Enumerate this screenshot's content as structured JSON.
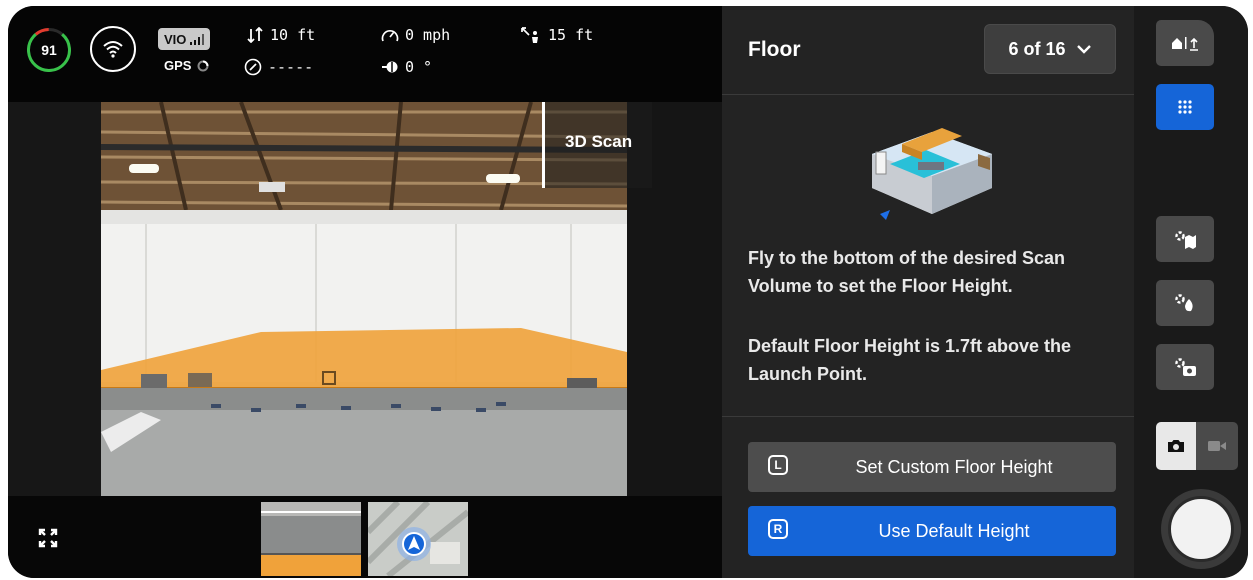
{
  "telemetry": {
    "battery_percent": "91",
    "battery_level": 0.91,
    "vio_label": "VIO",
    "gps_label": "GPS",
    "altitude": "10 ft",
    "heading_value": "-----",
    "speed": "0 mph",
    "gimbal_angle": "0 °",
    "distance": "15 ft"
  },
  "camera": {
    "mode_label": "3D Scan"
  },
  "panel": {
    "title": "Floor",
    "step_label": "6 of 16",
    "instruction_1": "Fly to the bottom of the desired Scan Volume to set the Floor Height.",
    "instruction_2": "Default Floor Height is 1.7ft above the Launch Point.",
    "custom_button_key": "L",
    "custom_button_label": "Set Custom Floor Height",
    "default_button_key": "R",
    "default_button_label": "Use Default Height"
  },
  "colors": {
    "accent_blue": "#1565d8",
    "floor_orange": "#f0a23a",
    "battery_green": "#38c24a",
    "battery_red": "#e23b2e"
  },
  "icons": [
    "battery-ring-icon",
    "wifi-icon",
    "signal-bars-icon",
    "gps-spinner-icon",
    "vertical-arrows-icon",
    "compass-icon",
    "speedometer-icon",
    "gimbal-icon",
    "distance-home-icon",
    "expand-icon",
    "chevron-down-icon",
    "home-altitude-icon",
    "grid-icon",
    "scan-map-icon",
    "scan-settings-icon",
    "scan-camera-icon",
    "photo-icon",
    "video-icon",
    "shutter-icon"
  ]
}
